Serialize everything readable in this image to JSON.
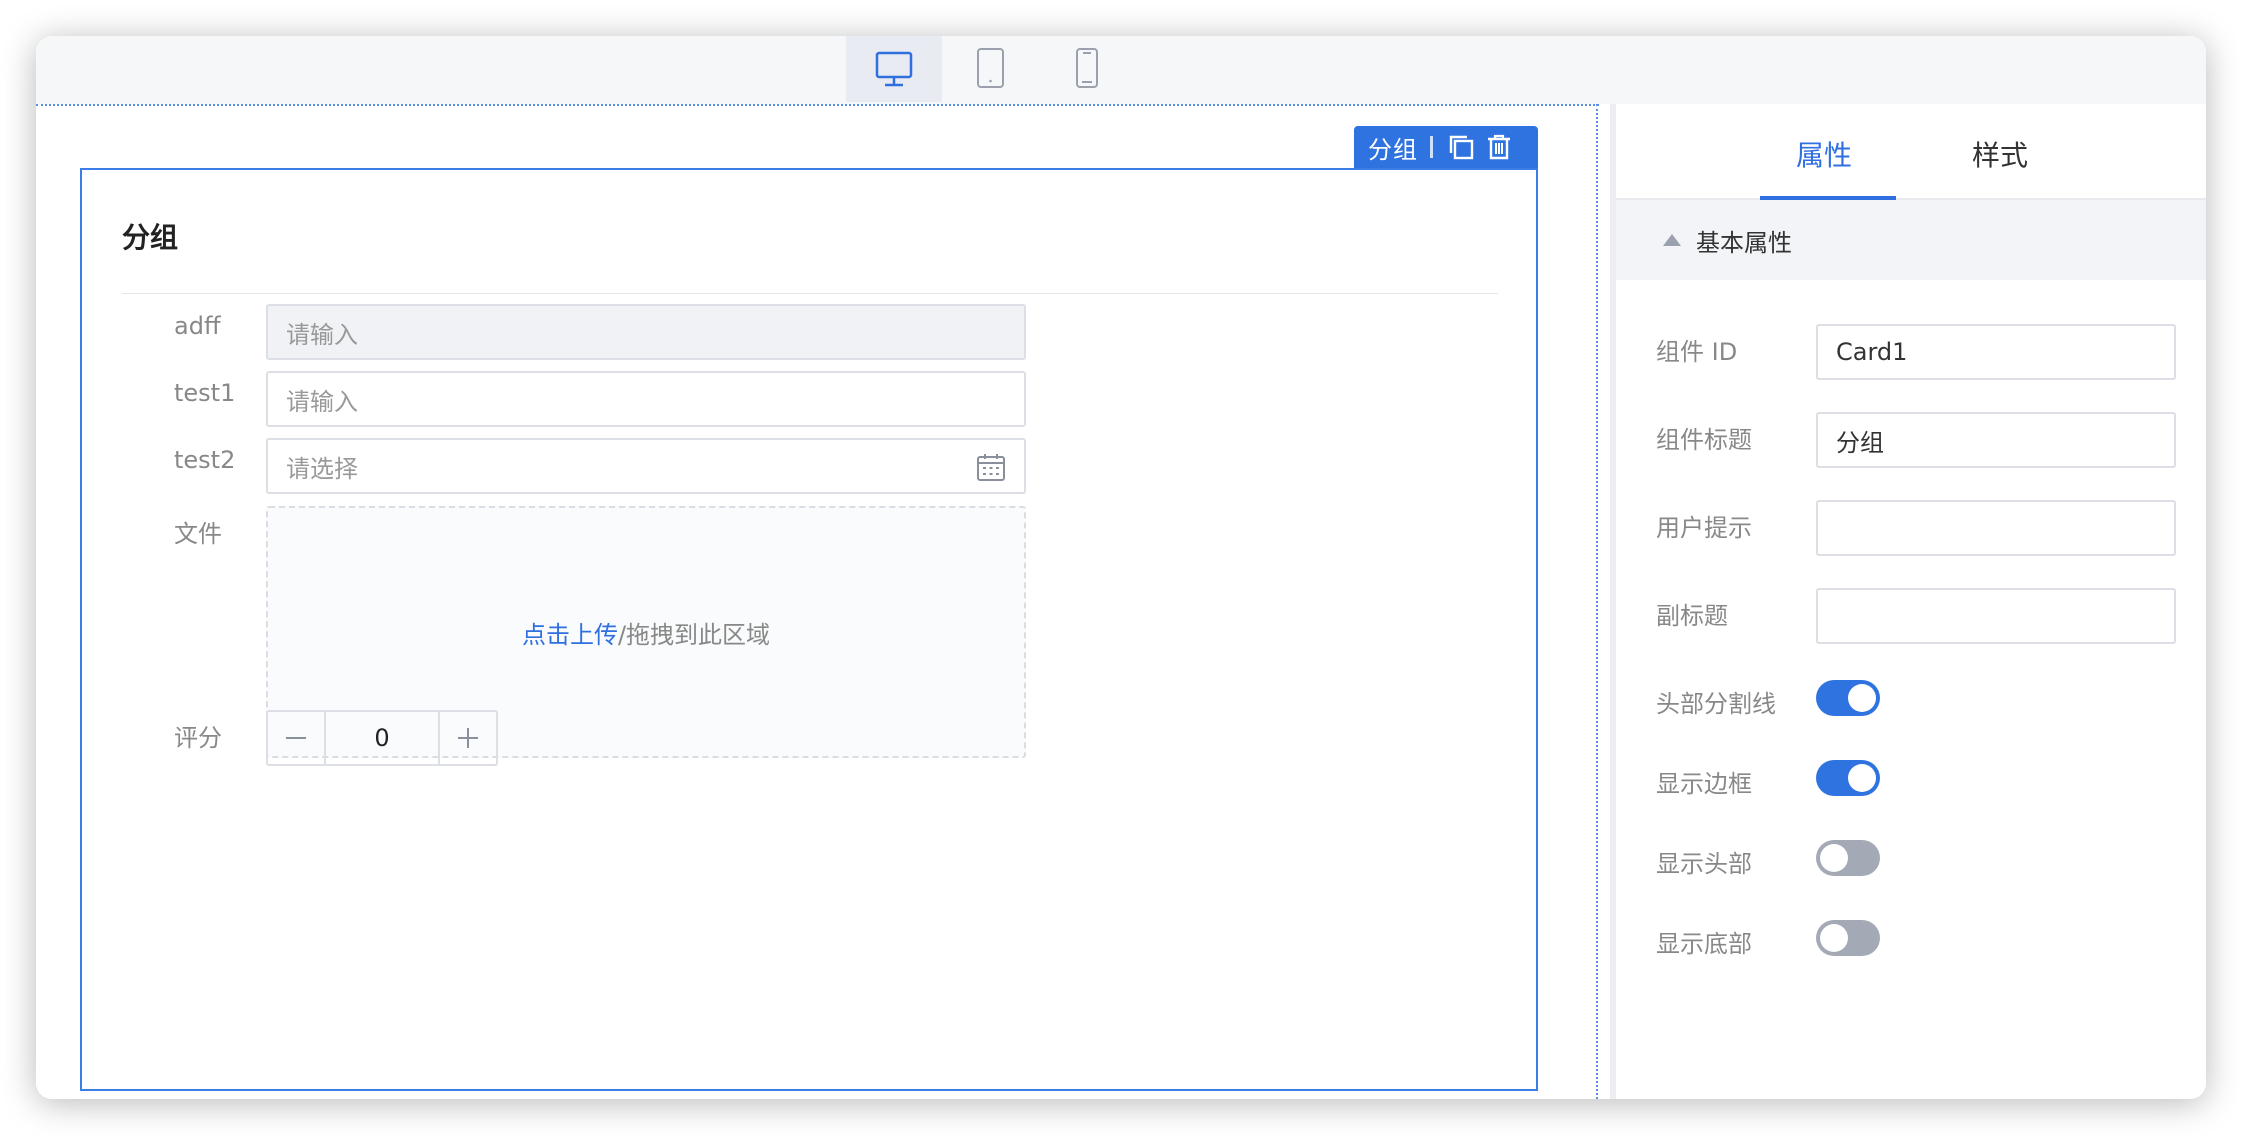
{
  "device_bar": {
    "devices": [
      {
        "name": "desktop-icon",
        "active": true
      },
      {
        "name": "tablet-icon",
        "active": false
      },
      {
        "name": "phone-icon",
        "active": false
      }
    ]
  },
  "canvas": {
    "toolbar": {
      "label": "分组"
    },
    "card": {
      "title": "分组",
      "fields": [
        {
          "label": "adff",
          "placeholder": "请输入",
          "type": "input-disabled"
        },
        {
          "label": "test1",
          "placeholder": "请输入",
          "type": "input"
        },
        {
          "label": "test2",
          "placeholder": "请选择",
          "type": "date"
        },
        {
          "label": "文件",
          "type": "upload",
          "upload_link": "点击上传",
          "upload_text": "/拖拽到此区域"
        },
        {
          "label": "评分",
          "type": "number",
          "value": "0"
        }
      ]
    }
  },
  "panel": {
    "tabs": [
      {
        "label": "属性",
        "active": true
      },
      {
        "label": "样式",
        "active": false
      }
    ],
    "section_title": "基本属性",
    "properties": [
      {
        "label": "组件 ID",
        "value": "Card1"
      },
      {
        "label": "组件标题",
        "value": "分组"
      },
      {
        "label": "用户提示",
        "value": ""
      },
      {
        "label": "副标题",
        "value": ""
      }
    ],
    "toggles": [
      {
        "label": "头部分割线",
        "on": true
      },
      {
        "label": "显示边框",
        "on": true
      },
      {
        "label": "显示头部",
        "on": false
      },
      {
        "label": "显示底部",
        "on": false
      }
    ]
  },
  "colors": {
    "accent": "#2f73e0",
    "switch_off": "#a4aab5"
  }
}
